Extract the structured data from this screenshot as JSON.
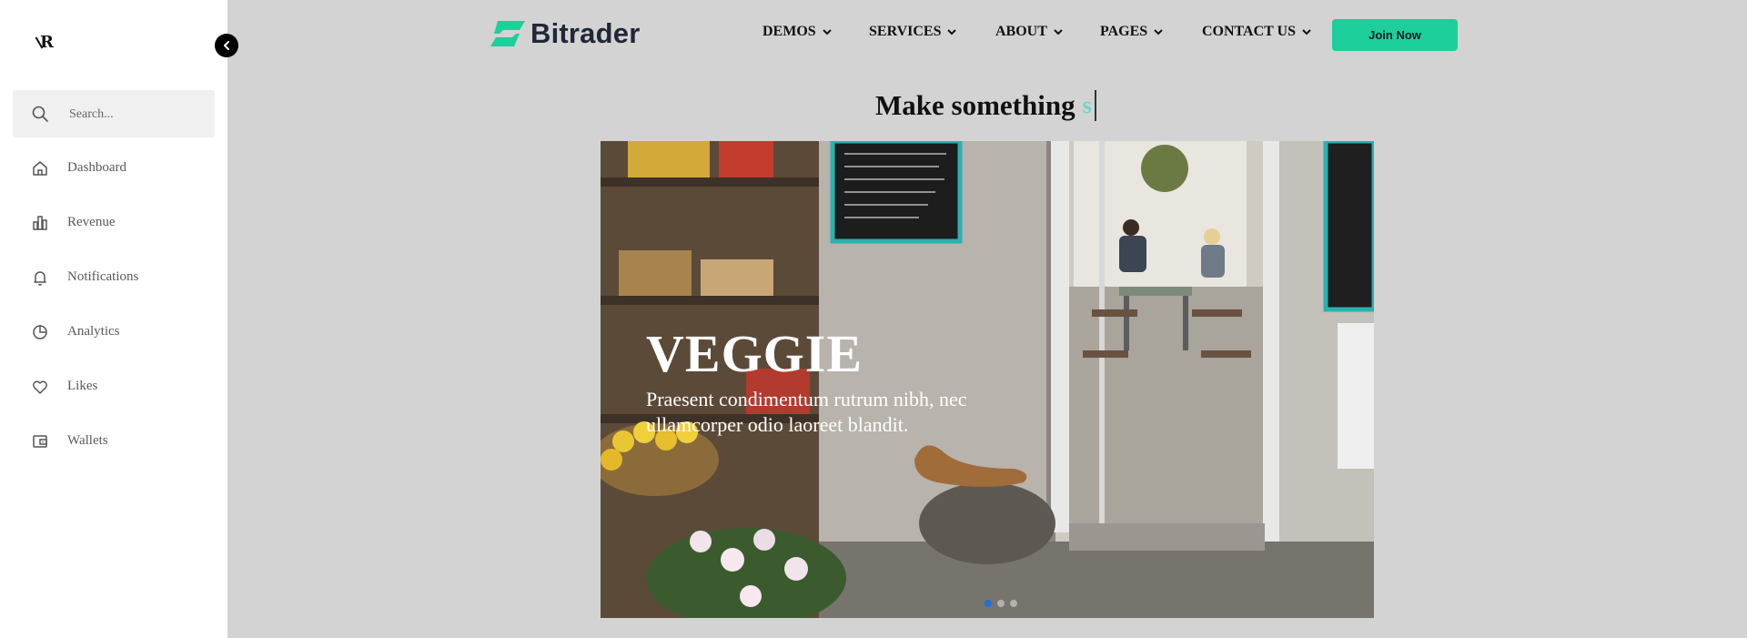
{
  "sidebar": {
    "logo_text": "R",
    "search_placeholder": "Search...",
    "items": [
      {
        "label": "Dashboard",
        "icon": "home-icon"
      },
      {
        "label": "Revenue",
        "icon": "bar-chart-icon"
      },
      {
        "label": "Notifications",
        "icon": "bell-icon"
      },
      {
        "label": "Analytics",
        "icon": "pie-chart-icon"
      },
      {
        "label": "Likes",
        "icon": "heart-icon"
      },
      {
        "label": "Wallets",
        "icon": "wallet-icon"
      }
    ]
  },
  "header": {
    "brand": "Bitrader",
    "menu": [
      {
        "label": "DEMOS"
      },
      {
        "label": "SERVICES"
      },
      {
        "label": "ABOUT"
      },
      {
        "label": "PAGES"
      },
      {
        "label": "CONTACT US"
      }
    ],
    "join_label": "Join Now"
  },
  "hero": {
    "headline": "Make something",
    "typed_text": "s",
    "slide_title": "VEGGIE",
    "slide_text": "Praesent condimentum rutrum nibh, nec ullamcorper odio laoreet blandit.",
    "slides_count": 3,
    "active_slide": 1
  },
  "colors": {
    "accent": "#1dcf9a",
    "page_bg": "#d3d3d3",
    "active_dot": "#1e6fd9"
  }
}
